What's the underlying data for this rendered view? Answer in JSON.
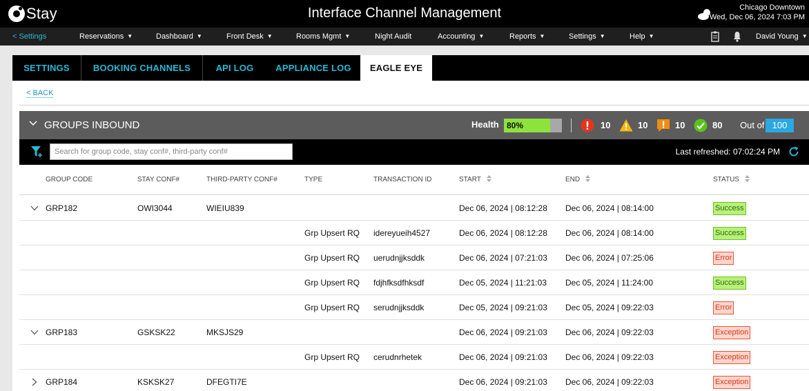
{
  "header": {
    "logo_text": "Stay",
    "title": "Interface Channel Management",
    "location": "Chicago Downtown",
    "datetime": "Wed, Dec 06, 2024 7:03 PM"
  },
  "nav": {
    "back": "< Settings",
    "items": [
      "Reservations",
      "Dashboard",
      "Front Desk",
      "Rooms Mgmt",
      "Night Audit",
      "Accounting",
      "Reports",
      "Settings",
      "Help"
    ],
    "user": "David Young"
  },
  "tabs": [
    "SETTINGS",
    "BOOKING CHANNELS",
    "API LOG",
    "APPLIANCE LOG",
    "EAGLE EYE"
  ],
  "active_tab": "EAGLE EYE",
  "back_link": "< BACK",
  "section": {
    "title": "GROUPS INBOUND",
    "health_label": "Health",
    "health_value": "80%",
    "health_fraction": 0.8,
    "errors": "10",
    "warnings": "10",
    "alerts": "10",
    "success": "80",
    "out_of_label": "Out of",
    "total": "100"
  },
  "filter": {
    "search_placeholder": "Search for group code, stay conf#, third-party conf#",
    "last_refreshed_label": "Last refreshed:",
    "last_refreshed_time": "07:02:24 PM"
  },
  "columns": [
    "GROUP CODE",
    "STAY CONF#",
    "THIRD-PARTY CONF#",
    "TYPE",
    "TRANSACTION ID",
    "START",
    "END",
    "STATUS"
  ],
  "rows": [
    {
      "expand": "down",
      "group": "GRP182",
      "stay": "OWI3044",
      "third": "WIEIU839",
      "type": "",
      "txn": "",
      "start": "Dec 06, 2024 | 08:12:28",
      "end": "Dec 06, 2024 | 08:14:00",
      "status": "Success"
    },
    {
      "expand": "",
      "group": "",
      "stay": "",
      "third": "",
      "type": "Grp Upsert RQ",
      "txn": "idereyueih4527",
      "start": "Dec 06, 2024 | 08:12:28",
      "end": "Dec 06, 2024 | 08:14:00",
      "status": "Success"
    },
    {
      "expand": "",
      "group": "",
      "stay": "",
      "third": "",
      "type": "Grp Upsert RQ",
      "txn": "uerudnjjksddk",
      "start": "Dec 06, 2024 | 07:21:03",
      "end": "Dec 06, 2024 | 07:25:06",
      "status": "Error"
    },
    {
      "expand": "",
      "group": "",
      "stay": "",
      "third": "",
      "type": "Grp Upsert RQ",
      "txn": "fdjhfksdfhksdf",
      "start": "Dec 05, 2024 | 11:21:03",
      "end": "Dec 05, 2024 | 11:24:00",
      "status": "Success"
    },
    {
      "expand": "",
      "group": "",
      "stay": "",
      "third": "",
      "type": "Grp Upsert RQ",
      "txn": "serudnjjksddk",
      "start": "Dec 05, 2024 | 09:21:03",
      "end": "Dec 05, 2024 | 09:22:03",
      "status": "Error"
    },
    {
      "expand": "down",
      "group": "GRP183",
      "stay": "GSKSK22",
      "third": "MKSJS29",
      "type": "",
      "txn": "",
      "start": "Dec 06, 2024 | 09:21:03",
      "end": "Dec 06, 2024 | 09:22:03",
      "status": "Exception"
    },
    {
      "expand": "",
      "group": "",
      "stay": "",
      "third": "",
      "type": "Grp Upsert RQ",
      "txn": "cerudnrhetek",
      "start": "Dec 06, 2024 | 09:21:03",
      "end": "Dec 06, 2024 | 09:22:03",
      "status": "Exception"
    },
    {
      "expand": "right",
      "group": "GRP184",
      "stay": "KSKSK27",
      "third": "DFEGTI7E",
      "type": "",
      "txn": "",
      "start": "Dec 06, 2024 | 09:21:03",
      "end": "Dec 06, 2024 | 09:22:03",
      "status": "Exception"
    }
  ],
  "colors": {
    "accent": "#2ab7d6",
    "health": "#8de23c",
    "error": "#e8321e",
    "warning": "#f5b80a",
    "alert": "#f08c10",
    "success": "#57c41c",
    "total": "#2aa8e0"
  }
}
